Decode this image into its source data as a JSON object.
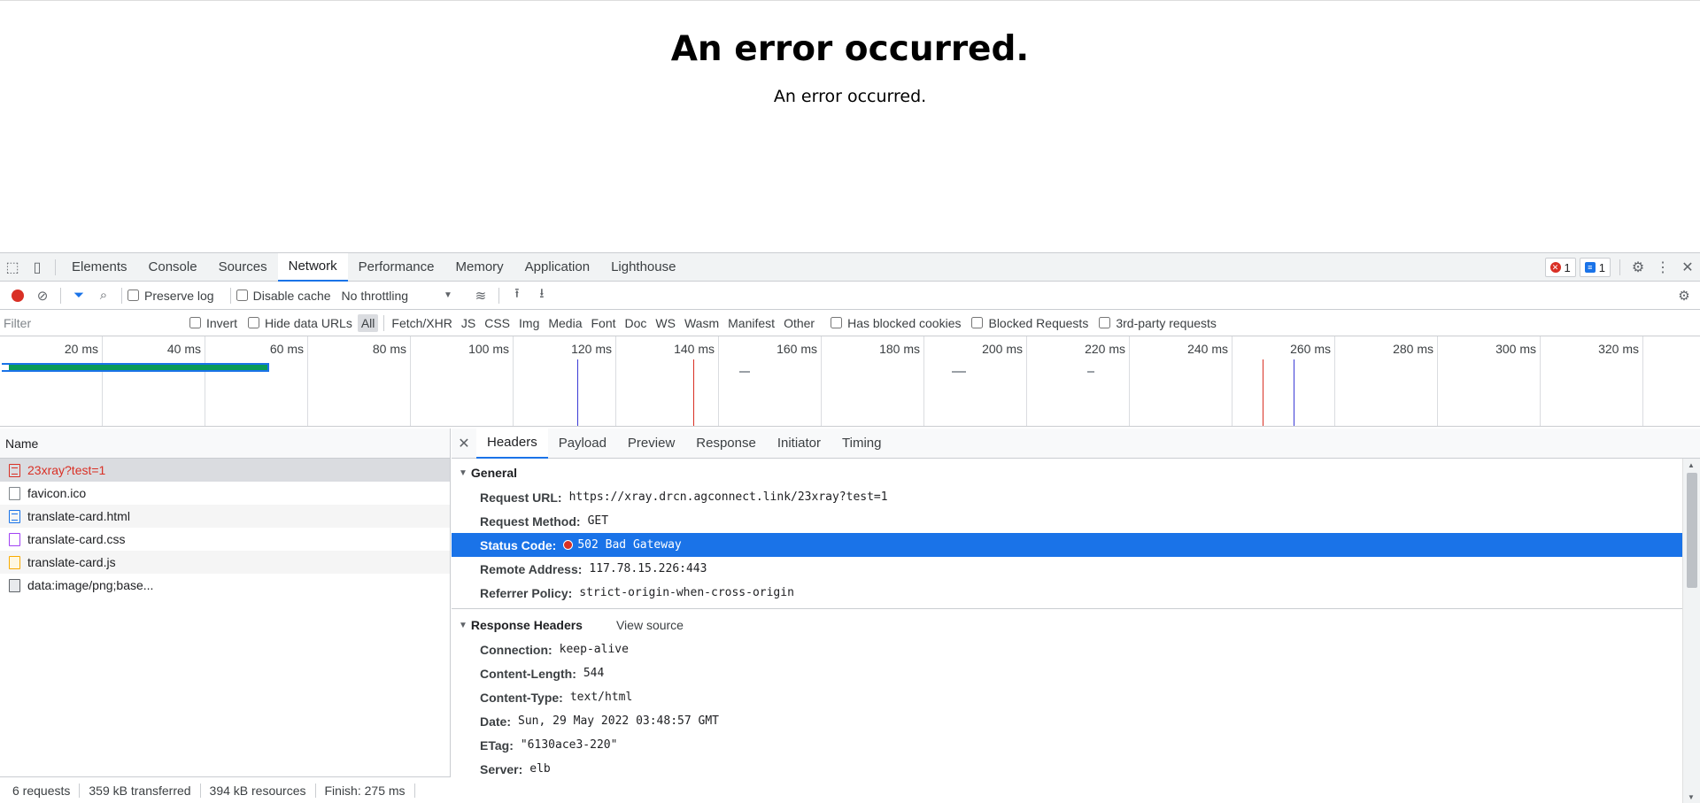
{
  "page": {
    "heading": "An error occurred.",
    "message": "An error occurred."
  },
  "devtools": {
    "tabs": [
      "Elements",
      "Console",
      "Sources",
      "Network",
      "Performance",
      "Memory",
      "Application",
      "Lighthouse"
    ],
    "active_tab": "Network",
    "error_count": "1",
    "message_count": "1"
  },
  "toolbar": {
    "preserve_log": "Preserve log",
    "disable_cache": "Disable cache",
    "throttling": "No throttling"
  },
  "filterbar": {
    "placeholder": "Filter",
    "invert": "Invert",
    "hide_data_urls": "Hide data URLs",
    "types": [
      "All",
      "Fetch/XHR",
      "JS",
      "CSS",
      "Img",
      "Media",
      "Font",
      "Doc",
      "WS",
      "Wasm",
      "Manifest",
      "Other"
    ],
    "has_blocked_cookies": "Has blocked cookies",
    "blocked_requests": "Blocked Requests",
    "third_party": "3rd-party requests"
  },
  "overview": {
    "ticks": [
      "20 ms",
      "40 ms",
      "60 ms",
      "80 ms",
      "100 ms",
      "120 ms",
      "140 ms",
      "160 ms",
      "180 ms",
      "200 ms",
      "220 ms",
      "240 ms",
      "260 ms",
      "280 ms",
      "300 ms",
      "320 ms"
    ]
  },
  "requests": {
    "header": "Name",
    "items": [
      {
        "name": "23xray?test=1",
        "type": "err"
      },
      {
        "name": "favicon.ico",
        "type": "plain"
      },
      {
        "name": "translate-card.html",
        "type": "doc"
      },
      {
        "name": "translate-card.css",
        "type": "css"
      },
      {
        "name": "translate-card.js",
        "type": "js"
      },
      {
        "name": "data:image/png;base...",
        "type": "img"
      }
    ]
  },
  "status_bar": {
    "requests": "6 requests",
    "transferred": "359 kB transferred",
    "resources": "394 kB resources",
    "finish": "Finish: 275 ms"
  },
  "detail": {
    "tabs": [
      "Headers",
      "Payload",
      "Preview",
      "Response",
      "Initiator",
      "Timing"
    ],
    "active_tab": "Headers",
    "general": {
      "title": "General",
      "rows": [
        {
          "k": "Request URL:",
          "v": "https://xray.drcn.agconnect.link/23xray?test=1"
        },
        {
          "k": "Request Method:",
          "v": "GET"
        },
        {
          "k": "Status Code:",
          "v": "502 Bad Gateway"
        },
        {
          "k": "Remote Address:",
          "v": "117.78.15.226:443"
        },
        {
          "k": "Referrer Policy:",
          "v": "strict-origin-when-cross-origin"
        }
      ]
    },
    "response_headers": {
      "title": "Response Headers",
      "view_source": "View source",
      "rows": [
        {
          "k": "Connection:",
          "v": "keep-alive"
        },
        {
          "k": "Content-Length:",
          "v": "544"
        },
        {
          "k": "Content-Type:",
          "v": "text/html"
        },
        {
          "k": "Date:",
          "v": "Sun, 29 May 2022 03:48:57 GMT"
        },
        {
          "k": "ETag:",
          "v": "\"6130ace3-220\""
        },
        {
          "k": "Server:",
          "v": "elb"
        }
      ]
    }
  }
}
